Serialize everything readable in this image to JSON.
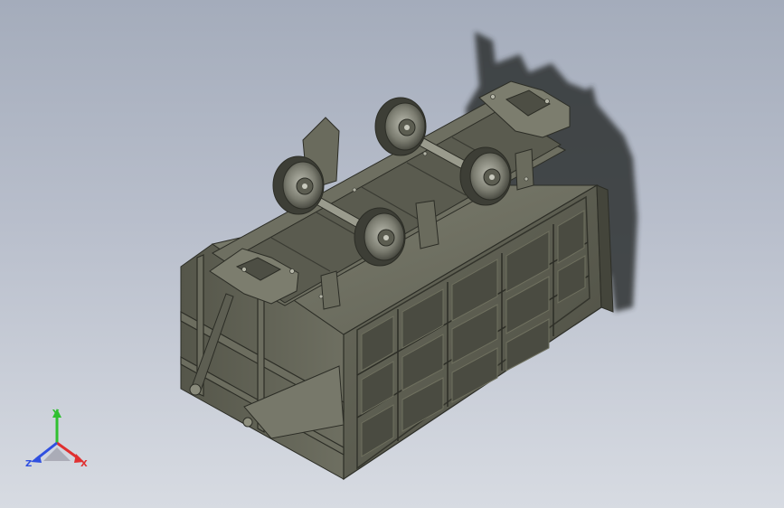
{
  "app": {
    "window_title": ""
  },
  "viewport": {
    "background_top": "#a4acbb",
    "background_bottom": "#d7dbe2"
  },
  "model": {
    "description_icon": "mine-car-3d-model",
    "body_color": "#5e5f52",
    "body_dark": "#3f4037",
    "body_light": "#8a8b7c",
    "shadow_color": "#2f3133"
  },
  "triad": {
    "x_label": "X",
    "y_label": "Y",
    "z_label": "Z",
    "x_color": "#e03030",
    "y_color": "#30c030",
    "z_color": "#3050e0"
  }
}
